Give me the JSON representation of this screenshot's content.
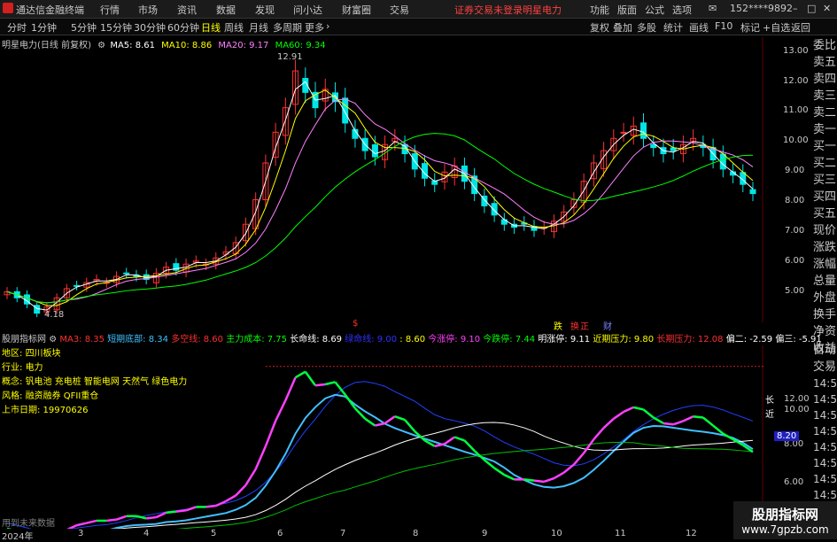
{
  "menu": {
    "app_title": "通达信金融终端",
    "items": [
      "行情",
      "市场",
      "资讯",
      "数据",
      "发现",
      "问小达",
      "财富圈",
      "交易"
    ],
    "login_notice": "证券交易未登录",
    "stock_name": "明星电力",
    "right_items": [
      "功能",
      "版面",
      "公式",
      "选项"
    ],
    "user": "152****9892"
  },
  "toolbar": {
    "periods": [
      "分时",
      "1分钟",
      "5分钟",
      "15分钟",
      "30分钟",
      "60分钟",
      "日线",
      "周线",
      "月线",
      "多周期",
      "更多"
    ],
    "selected_period": "日线",
    "right_buttons": [
      "复权",
      "叠加",
      "多股",
      "统计",
      "画线",
      "F10",
      "标记",
      "+自选",
      "返回"
    ]
  },
  "chart_header": {
    "title": "明星电力(日线 前复权)",
    "ma5": "MA5: 8.61",
    "ma10": "MA10: 8.86",
    "ma20": "MA20: 9.17",
    "ma60": "MA60: 9.34",
    "high_label": "12.91",
    "low_label": "4.18"
  },
  "indicator_header": {
    "title": "股朋指标网",
    "ma3": "MA3: 8.35",
    "short_bottom": "短期底部: 8.34",
    "bull_bear": "多空线: 8.60",
    "main_cost": "主力成本: 7.75",
    "long_line": "长命线: 8.69",
    "green_line": "绿命线: 9.00",
    "v8": ": 8.60",
    "today_up": "今涨停: 9.10",
    "today_down": "今跌停: 7.44",
    "tomorrow_up": "明涨停: 9.11",
    "near_press": "近期压力: 9.80",
    "long_press": "长期压力: 12.08",
    "dev2": "偏二: -2.59",
    "dev3": "偏三: -5.91"
  },
  "info_box": {
    "region": "地区:",
    "region_val": "四川板块",
    "industry": "行业:",
    "industry_val": "电力",
    "concept": "概念:",
    "concept_val": "钒电池 充电桩 智能电网 天然气 绿色电力",
    "style": "风格:",
    "style_val": "融资融券 QFII重仓",
    "listing": "上市日期: 19970626"
  },
  "future_label": "用到未来数据",
  "markers": {
    "b": "$",
    "diegu": "跌",
    "huanzheng": "换",
    "yi": "正",
    "cai": "财"
  },
  "side_panel_top": [
    "委比",
    "卖五",
    "卖四",
    "卖三",
    "卖二",
    "卖一",
    "买一",
    "买二",
    "买三",
    "买四",
    "买五",
    "现价",
    "涨跌",
    "涨幅",
    "总量",
    "外盘",
    "换手",
    "净资",
    "收益"
  ],
  "side_panel_bottom": [
    "自动",
    "交易"
  ],
  "price_axis": [
    "13.00",
    "12.00",
    "11.00",
    "10.00",
    "9.00",
    "8.00",
    "7.00",
    "6.00",
    "5.00"
  ],
  "ind_axis": [
    "12.00",
    "10.00",
    "8.00",
    "6.00"
  ],
  "ind_axis_right": [
    "14:5",
    "14:5",
    "14:5",
    "14:5",
    "14:5",
    "14:5",
    "14:5",
    "14:5",
    "14:5"
  ],
  "ind_labels": {
    "long": "长",
    "near": "近",
    "current": "8.20"
  },
  "date_axis": [
    "2024年",
    "3",
    "4",
    "5",
    "6",
    "7",
    "8",
    "9",
    "10",
    "11",
    "12"
  ],
  "watermark": {
    "name": "股朋指标网",
    "url": "www.7gpzb.com"
  },
  "colors": {
    "up": "#ff3232",
    "down": "#00e6e6",
    "ma5": "#ffffff",
    "ma10": "#ffff00",
    "ma20": "#ff80ff",
    "ma60": "#00ff00"
  },
  "chart_data": {
    "type": "candlestick",
    "ylim": [
      4.0,
      13.3
    ],
    "x_axis": [
      "2024年",
      "3",
      "4",
      "5",
      "6",
      "7",
      "8",
      "9",
      "10",
      "11",
      "12"
    ],
    "annotations": [
      "12.91",
      "4.18"
    ],
    "close": [
      5.0,
      4.8,
      4.6,
      4.3,
      4.5,
      4.8,
      5.1,
      5.2,
      5.3,
      5.4,
      5.3,
      5.5,
      5.6,
      5.5,
      5.4,
      5.6,
      5.8,
      5.7,
      5.9,
      6.0,
      5.9,
      6.1,
      6.3,
      6.6,
      7.2,
      8.0,
      9.2,
      10.2,
      11.0,
      12.2,
      11.5,
      11.0,
      11.6,
      11.2,
      10.5,
      10.0,
      9.6,
      9.4,
      9.8,
      10.0,
      9.5,
      9.0,
      8.7,
      8.5,
      8.9,
      9.1,
      8.6,
      8.2,
      7.8,
      7.5,
      7.2,
      7.1,
      7.2,
      7.0,
      7.1,
      7.3,
      7.6,
      8.0,
      8.6,
      9.2,
      9.6,
      10.0,
      10.2,
      10.4,
      10.0,
      9.7,
      9.5,
      9.6,
      9.8,
      10.0,
      9.7,
      9.3,
      9.0,
      8.8,
      8.5,
      8.2
    ]
  }
}
